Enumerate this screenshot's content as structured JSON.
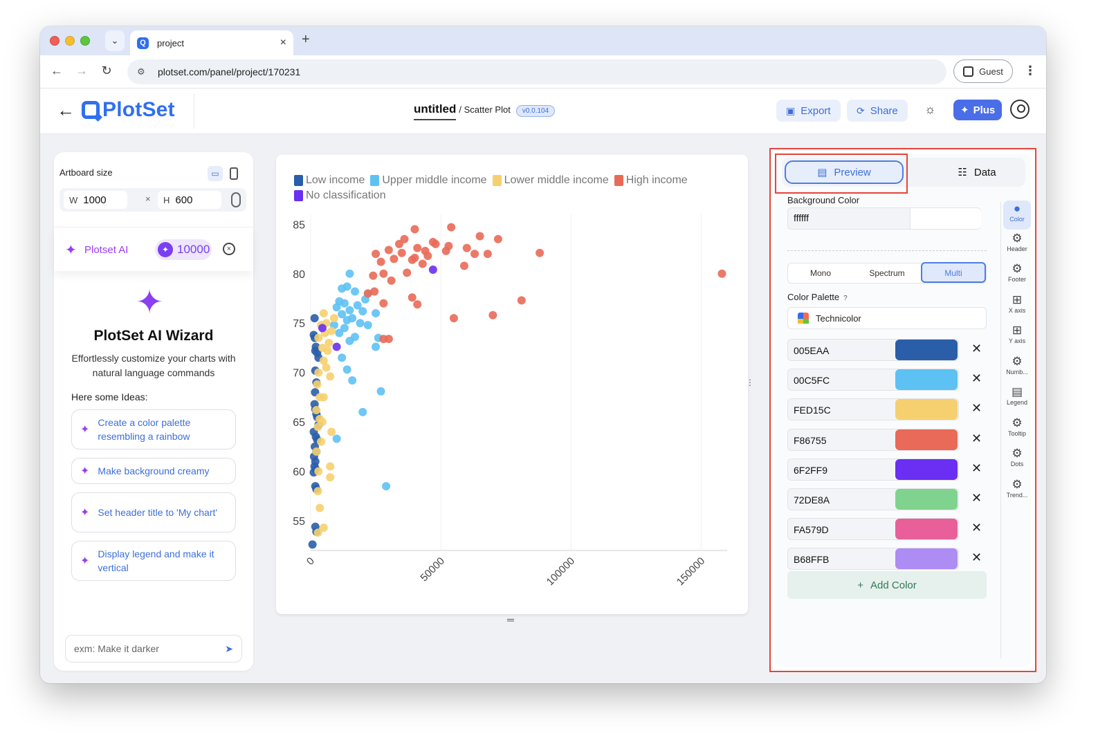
{
  "browser": {
    "tab_title": "project",
    "url": "plotset.com/panel/project/170231",
    "guest_label": "Guest"
  },
  "header": {
    "logo_text": "PlotSet",
    "project_title": "untitled",
    "chart_type": "/ Scatter Plot",
    "version": "v0.0.104",
    "export_label": "Export",
    "share_label": "Share",
    "plus_label": "Plus"
  },
  "left_panel": {
    "artboard_label": "Artboard size",
    "width_key": "W",
    "width_value": "1000",
    "times": "×",
    "height_key": "H",
    "height_value": "600",
    "ai_label": "Plotset AI",
    "credits": "10000",
    "wizard_title": "PlotSet AI Wizard",
    "wizard_desc": "Effortlessly customize your charts with natural language commands",
    "ideas_label": "Here some Ideas:",
    "ideas": [
      "Create a color palette resembling a rainbow",
      "Make background creamy",
      "Set header title to 'My chart'",
      "Display legend and make it vertical"
    ],
    "input_placeholder": "exm: Make it darker"
  },
  "right_panel": {
    "preview_label": "Preview",
    "data_label": "Data",
    "bg_color_label": "Background Color",
    "bg_color_value": "ffffff",
    "modes": [
      "Mono",
      "Spectrum",
      "Multi"
    ],
    "active_mode": "Multi",
    "palette_label": "Color Palette",
    "palette_help": "?",
    "palette_name": "Technicolor",
    "colors": [
      {
        "hex": "005EAA",
        "color": "#2a5ea8"
      },
      {
        "hex": "00C5FC",
        "color": "#5ec1f4"
      },
      {
        "hex": "FED15C",
        "color": "#f6d06f"
      },
      {
        "hex": "F86755",
        "color": "#e96a58"
      },
      {
        "hex": "6F2FF9",
        "color": "#6a2ff2"
      },
      {
        "hex": "72DE8A",
        "color": "#80d38e"
      },
      {
        "hex": "FA579D",
        "color": "#e85f99"
      },
      {
        "hex": "B68FFB",
        "color": "#ad8cf3"
      }
    ],
    "add_color_label": "Add Color",
    "side_tabs": [
      "Color",
      "Header",
      "Footer",
      "X axis",
      "Y axis",
      "Numb...",
      "Legend",
      "Tooltip",
      "Dots",
      "Trend..."
    ]
  },
  "chart_data": {
    "type": "scatter",
    "title": "",
    "xlabel": "",
    "ylabel": "",
    "xlim": [
      0,
      160000
    ],
    "ylim": [
      52,
      86
    ],
    "x_ticks": [
      "0",
      "50000",
      "100000",
      "150000"
    ],
    "y_ticks": [
      "55",
      "60",
      "65",
      "70",
      "75",
      "80",
      "85"
    ],
    "legend_position": "top-left",
    "series": [
      {
        "name": "Low income",
        "color": "#2a5ea8",
        "points": [
          [
            1500,
            75.5
          ],
          [
            1200,
            73.8
          ],
          [
            1600,
            73.5
          ],
          [
            1800,
            72.2
          ],
          [
            2000,
            72.6
          ],
          [
            2500,
            72.0
          ],
          [
            3000,
            71.5
          ],
          [
            1800,
            70.2
          ],
          [
            2200,
            69.0
          ],
          [
            1700,
            68.0
          ],
          [
            1500,
            66.8
          ],
          [
            1800,
            66.3
          ],
          [
            2200,
            65.8
          ],
          [
            2500,
            65.5
          ],
          [
            3000,
            64.7
          ],
          [
            1200,
            64.0
          ],
          [
            2000,
            63.5
          ],
          [
            2500,
            63.2
          ],
          [
            1600,
            62.5
          ],
          [
            2200,
            62.0
          ],
          [
            1300,
            61.5
          ],
          [
            1800,
            61.0
          ],
          [
            1500,
            60.5
          ],
          [
            2000,
            60.2
          ],
          [
            1200,
            59.9
          ],
          [
            1800,
            58.5
          ],
          [
            2200,
            58.2
          ],
          [
            1800,
            54.4
          ],
          [
            2200,
            53.9
          ],
          [
            700,
            52.6
          ]
        ]
      },
      {
        "name": "Upper middle income",
        "color": "#5ec1f4",
        "points": [
          [
            15000,
            80.0
          ],
          [
            14000,
            78.7
          ],
          [
            12000,
            78.5
          ],
          [
            17000,
            78.2
          ],
          [
            22000,
            78.0
          ],
          [
            21000,
            77.4
          ],
          [
            11000,
            77.2
          ],
          [
            13000,
            77.0
          ],
          [
            18000,
            76.8
          ],
          [
            10000,
            76.6
          ],
          [
            15000,
            76.3
          ],
          [
            20000,
            76.2
          ],
          [
            25000,
            76.0
          ],
          [
            12000,
            75.9
          ],
          [
            16000,
            75.5
          ],
          [
            14000,
            75.3
          ],
          [
            19000,
            75.0
          ],
          [
            22000,
            74.8
          ],
          [
            9000,
            74.8
          ],
          [
            13000,
            74.5
          ],
          [
            11000,
            74.0
          ],
          [
            17000,
            73.6
          ],
          [
            26000,
            73.5
          ],
          [
            15000,
            73.2
          ],
          [
            25000,
            72.6
          ],
          [
            12000,
            71.5
          ],
          [
            14000,
            70.3
          ],
          [
            16000,
            69.2
          ],
          [
            27000,
            68.1
          ],
          [
            20000,
            66.0
          ],
          [
            10000,
            63.3
          ],
          [
            29000,
            58.5
          ]
        ]
      },
      {
        "name": "Lower middle income",
        "color": "#f6d06f",
        "points": [
          [
            5000,
            76.0
          ],
          [
            9000,
            75.5
          ],
          [
            6000,
            75.0
          ],
          [
            4000,
            74.8
          ],
          [
            8000,
            74.2
          ],
          [
            5500,
            74.0
          ],
          [
            3000,
            73.5
          ],
          [
            7000,
            73.0
          ],
          [
            4500,
            72.5
          ],
          [
            6500,
            72.2
          ],
          [
            5000,
            71.2
          ],
          [
            6000,
            70.5
          ],
          [
            3000,
            70.0
          ],
          [
            7500,
            69.6
          ],
          [
            2500,
            68.8
          ],
          [
            3500,
            67.5
          ],
          [
            5000,
            67.5
          ],
          [
            2200,
            66.2
          ],
          [
            3500,
            65.3
          ],
          [
            4500,
            65.0
          ],
          [
            2800,
            64.5
          ],
          [
            8000,
            64.0
          ],
          [
            4000,
            63.0
          ],
          [
            2200,
            62.0
          ],
          [
            7500,
            60.5
          ],
          [
            3000,
            60.0
          ],
          [
            7500,
            59.4
          ],
          [
            2800,
            58.0
          ],
          [
            3500,
            56.3
          ],
          [
            5000,
            54.3
          ],
          [
            2800,
            53.8
          ]
        ]
      },
      {
        "name": "High income",
        "color": "#e96a58",
        "points": [
          [
            40000,
            84.5
          ],
          [
            54000,
            84.7
          ],
          [
            65000,
            83.8
          ],
          [
            72000,
            83.5
          ],
          [
            36000,
            83.5
          ],
          [
            47000,
            83.2
          ],
          [
            34000,
            83.0
          ],
          [
            48000,
            83.0
          ],
          [
            60000,
            82.6
          ],
          [
            53000,
            82.8
          ],
          [
            41000,
            82.6
          ],
          [
            44000,
            82.3
          ],
          [
            30000,
            82.4
          ],
          [
            25000,
            82.0
          ],
          [
            35000,
            82.1
          ],
          [
            52000,
            82.3
          ],
          [
            68000,
            82.0
          ],
          [
            63000,
            82.0
          ],
          [
            88000,
            82.1
          ],
          [
            45000,
            81.8
          ],
          [
            40000,
            81.6
          ],
          [
            39000,
            81.4
          ],
          [
            32000,
            81.5
          ],
          [
            27000,
            81.2
          ],
          [
            43000,
            81.0
          ],
          [
            59000,
            80.8
          ],
          [
            37000,
            80.1
          ],
          [
            28000,
            80.0
          ],
          [
            24000,
            79.8
          ],
          [
            31000,
            79.3
          ],
          [
            24500,
            78.2
          ],
          [
            22000,
            78.0
          ],
          [
            39000,
            77.6
          ],
          [
            28000,
            77.0
          ],
          [
            41000,
            76.9
          ],
          [
            81000,
            77.3
          ],
          [
            55000,
            75.5
          ],
          [
            70000,
            75.8
          ],
          [
            30000,
            73.4
          ],
          [
            28000,
            73.4
          ],
          [
            158000,
            80.0
          ]
        ]
      },
      {
        "name": "No classification",
        "color": "#6a2ff2",
        "points": [
          [
            47000,
            80.4
          ],
          [
            4500,
            74.5
          ],
          [
            10000,
            72.6
          ]
        ]
      }
    ]
  }
}
